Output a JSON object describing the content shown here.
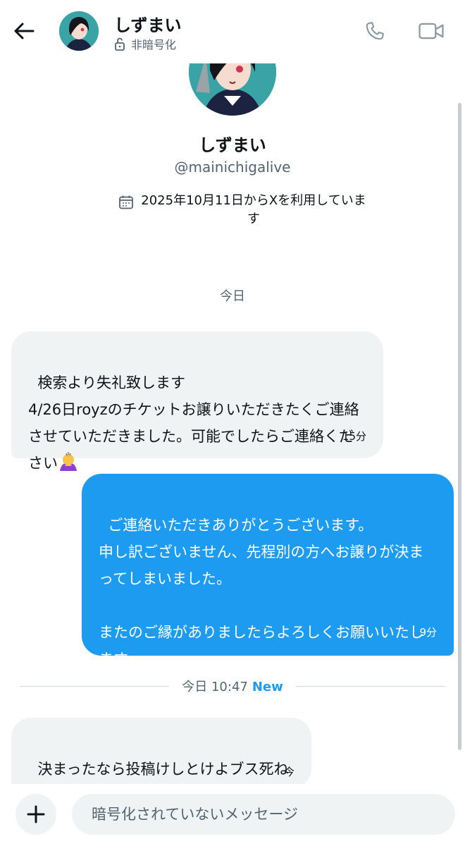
{
  "header": {
    "back_icon": "arrow-left-icon",
    "name": "しずまい",
    "status": "非暗号化",
    "lock_icon": "unlock-icon",
    "call_icon": "phone-icon",
    "video_icon": "video-camera-icon"
  },
  "profile": {
    "name": "しずまい",
    "handle": "@mainichigalive",
    "calendar_icon": "calendar-icon",
    "joined": "2025年10月11日からXを利用しています"
  },
  "conversation": {
    "date_separator": "今日",
    "messages": [
      {
        "direction": "received",
        "text": "検索より失礼致します\n4/26日royzのチケットお譲りいただきたくご連絡させていただきました。可能でしたらご連絡ください",
        "emoji": "person-bowing-emoji",
        "time": "15分"
      },
      {
        "direction": "sent",
        "text": "ご連絡いただきありがとうございます。\n申し訳ございません、先程別の方へお譲りが決まってしまいました。\n\nまたのご縁がありましたらよろしくお願いいたします。",
        "time": "9分"
      },
      {
        "direction": "received",
        "text": "決まったなら投稿けしとけよブス死ね",
        "time": "今"
      }
    ],
    "new_separator": {
      "label": "今日 10:47",
      "badge": "New"
    }
  },
  "composer": {
    "add_icon": "plus-icon",
    "placeholder": "暗号化されていないメッセージ"
  },
  "colors": {
    "accent": "#1d9bf0",
    "received_bubble": "#eff3f4",
    "secondary_text": "#536471"
  }
}
